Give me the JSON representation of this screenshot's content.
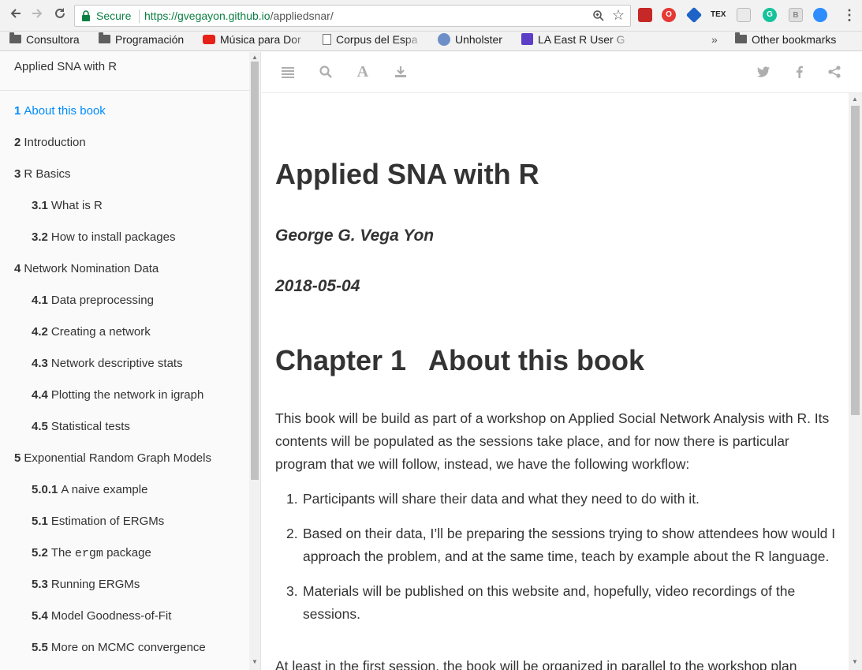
{
  "browser": {
    "secure_label": "Secure",
    "url_host": "https://gvegayon.github.io",
    "url_path": "/appliedsnar/",
    "bookmarks": [
      {
        "label": "Consultora",
        "icon": "folder-icon"
      },
      {
        "label": "Programación",
        "icon": "folder-icon"
      },
      {
        "label": "Música para Dor",
        "icon": "youtube-icon"
      },
      {
        "label": "Corpus del Espa",
        "icon": "page-icon"
      },
      {
        "label": "Unholster",
        "icon": "r-logo-icon"
      },
      {
        "label": "LA East R User G",
        "icon": "meetup-icon"
      }
    ],
    "overflow_label": "»",
    "other_bookmarks": "Other bookmarks",
    "extensions": [
      "bookmark-ext-icon",
      "opera-ext-icon",
      "stack-ext-icon",
      "tex-ext-icon",
      "photo-ext-icon",
      "grammarly-ext-icon",
      "b-ext-icon",
      "zoom-ext-icon"
    ],
    "tex_label": "TEX",
    "grammarly_label": "G",
    "b_label": "B"
  },
  "sidebar": {
    "title": "Applied SNA with R",
    "items": [
      {
        "num": "1",
        "label": "About this book",
        "level": 1,
        "active": true
      },
      {
        "num": "2",
        "label": "Introduction",
        "level": 1
      },
      {
        "num": "3",
        "label": "R Basics",
        "level": 1
      },
      {
        "num": "3.1",
        "label": "What is R",
        "level": 2
      },
      {
        "num": "3.2",
        "label": "How to install packages",
        "level": 2
      },
      {
        "num": "4",
        "label": "Network Nomination Data",
        "level": 1
      },
      {
        "num": "4.1",
        "label": "Data preprocessing",
        "level": 2
      },
      {
        "num": "4.2",
        "label": "Creating a network",
        "level": 2
      },
      {
        "num": "4.3",
        "label": "Network descriptive stats",
        "level": 2
      },
      {
        "num": "4.4",
        "label": "Plotting the network in igraph",
        "level": 2
      },
      {
        "num": "4.5",
        "label": "Statistical tests",
        "level": 2
      },
      {
        "num": "5",
        "label": "Exponential Random Graph Models",
        "level": 1
      },
      {
        "num": "5.0.1",
        "label": "A naive example",
        "level": 2
      },
      {
        "num": "5.1",
        "label": "Estimation of ERGMs",
        "level": 2
      },
      {
        "num": "5.2",
        "label": "The",
        "code": "ergm",
        "label_after": "package",
        "level": 2
      },
      {
        "num": "5.3",
        "label": "Running ERGMs",
        "level": 2
      },
      {
        "num": "5.4",
        "label": "Model Goodness-of-Fit",
        "level": 2
      },
      {
        "num": "5.5",
        "label": "More on MCMC convergence",
        "level": 2
      }
    ]
  },
  "toolbar": {
    "left_icons": [
      "menu-icon",
      "search-icon",
      "font-icon",
      "download-icon"
    ],
    "right_icons": [
      "twitter-icon",
      "facebook-icon",
      "share-icon"
    ],
    "font_glyph": "A"
  },
  "content": {
    "book_title": "Applied SNA with R",
    "author": "George G. Vega Yon",
    "date": "2018-05-04",
    "chapter_label": "Chapter 1",
    "chapter_title": "About this book",
    "intro_paragraph": "This book will be build as part of a workshop on Applied Social Network Analysis with R. Its contents will be populated as the sessions take place, and for now there is particular program that we will follow, instead, we have the following workflow:",
    "workflow": [
      {
        "num": "1.",
        "text": "Participants will share their data and what they need to do with it."
      },
      {
        "num": "2.",
        "text": "Based on their data, I’ll be preparing the sessions trying to show attendees how would I approach the problem, and at the same time, teach by example about the R language."
      },
      {
        "num": "3.",
        "text": "Materials will be published on this website and, hopefully, video recordings of the sessions."
      }
    ],
    "cut_line": "At least in the first session, the book will be organized in parallel to the workshop plan"
  },
  "colors": {
    "active_link": "#008cff",
    "secure_green": "#0b8043",
    "text": "#333333"
  }
}
